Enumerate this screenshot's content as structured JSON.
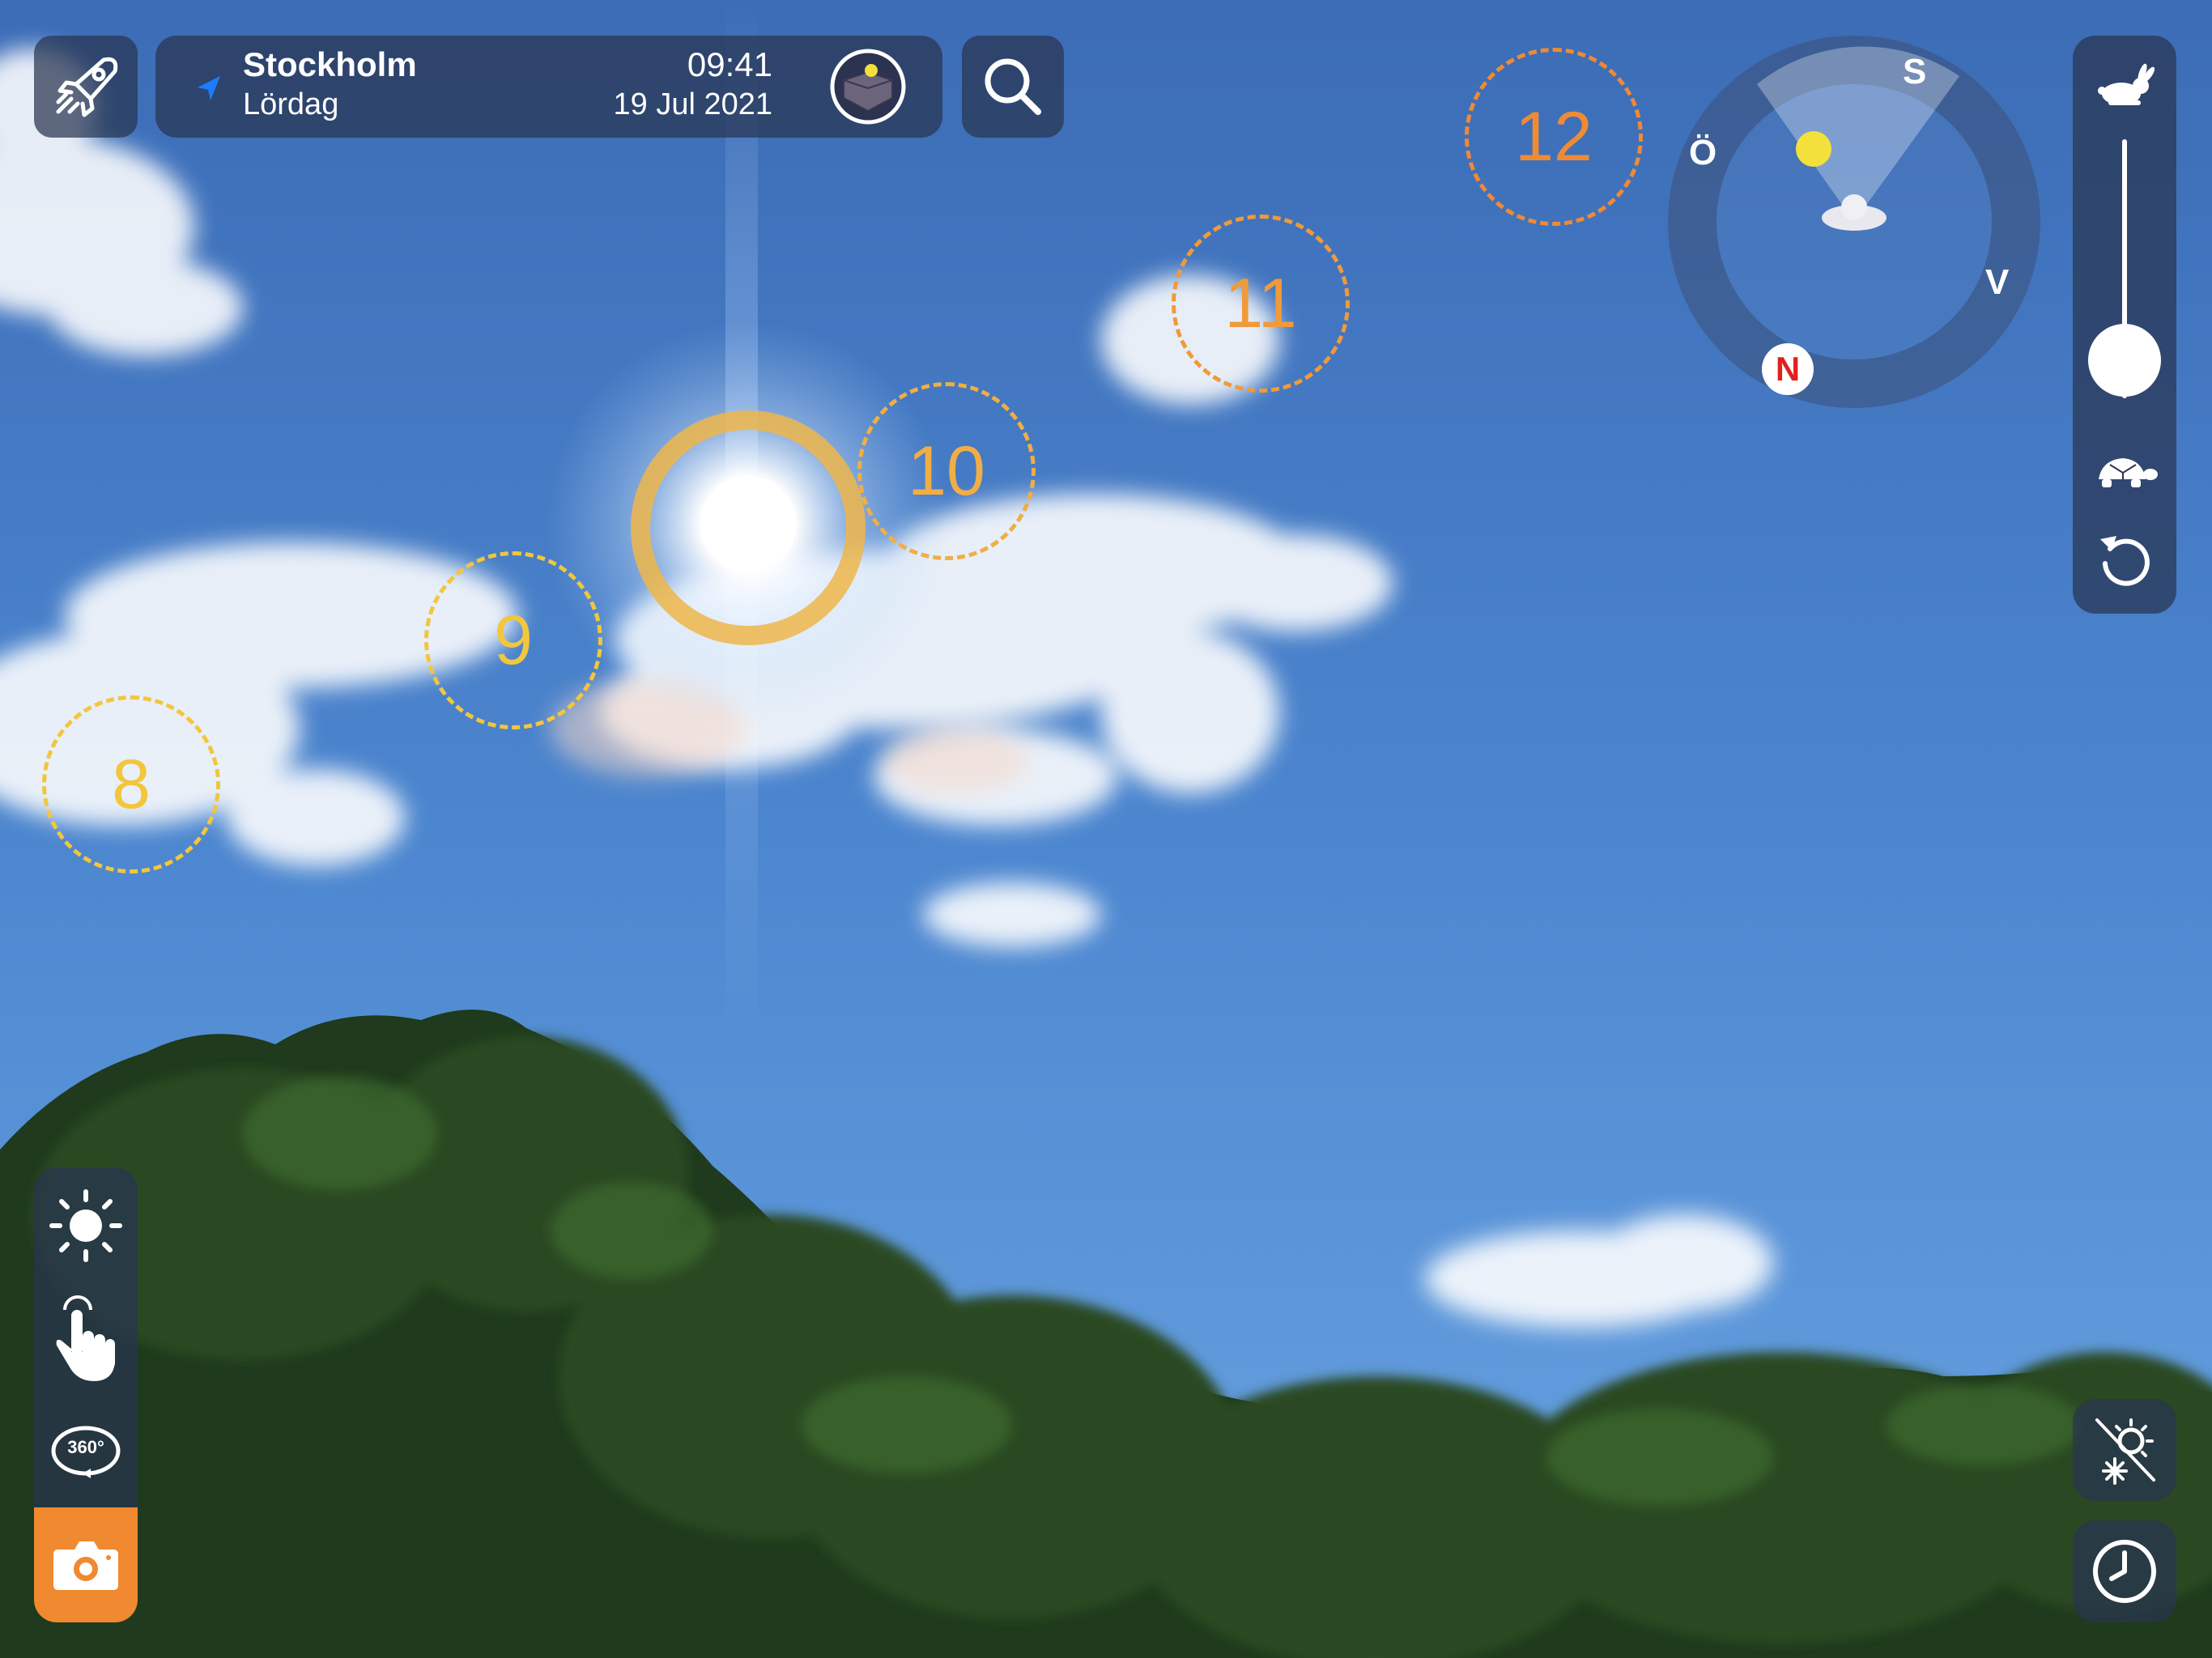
{
  "header": {
    "city": "Stockholm",
    "weekday": "Lördag",
    "time": "09:41",
    "date": "19 Jul 2021"
  },
  "hour_markers": [
    {
      "label": "8",
      "color": "#f2c63d"
    },
    {
      "label": "9",
      "color": "#f2c63d"
    },
    {
      "label": "10",
      "color": "#f0ae45"
    },
    {
      "label": "11",
      "color": "#f09a3b"
    },
    {
      "label": "12",
      "color": "#ef8a35"
    }
  ],
  "compass": {
    "south": "S",
    "east": "Ö",
    "west": "V",
    "north": "N"
  },
  "speed_slider": {
    "level": 0.0
  },
  "left_toolbar": {
    "items": [
      "sun-icon",
      "touch-hand-icon",
      "360-icon",
      "camera-icon"
    ],
    "active": "camera-icon",
    "label_360": "360°"
  },
  "colors": {
    "accent": "#f0892f",
    "sun_ring": "#eeb64a",
    "north_red": "#e02020",
    "panel": "#283450"
  }
}
